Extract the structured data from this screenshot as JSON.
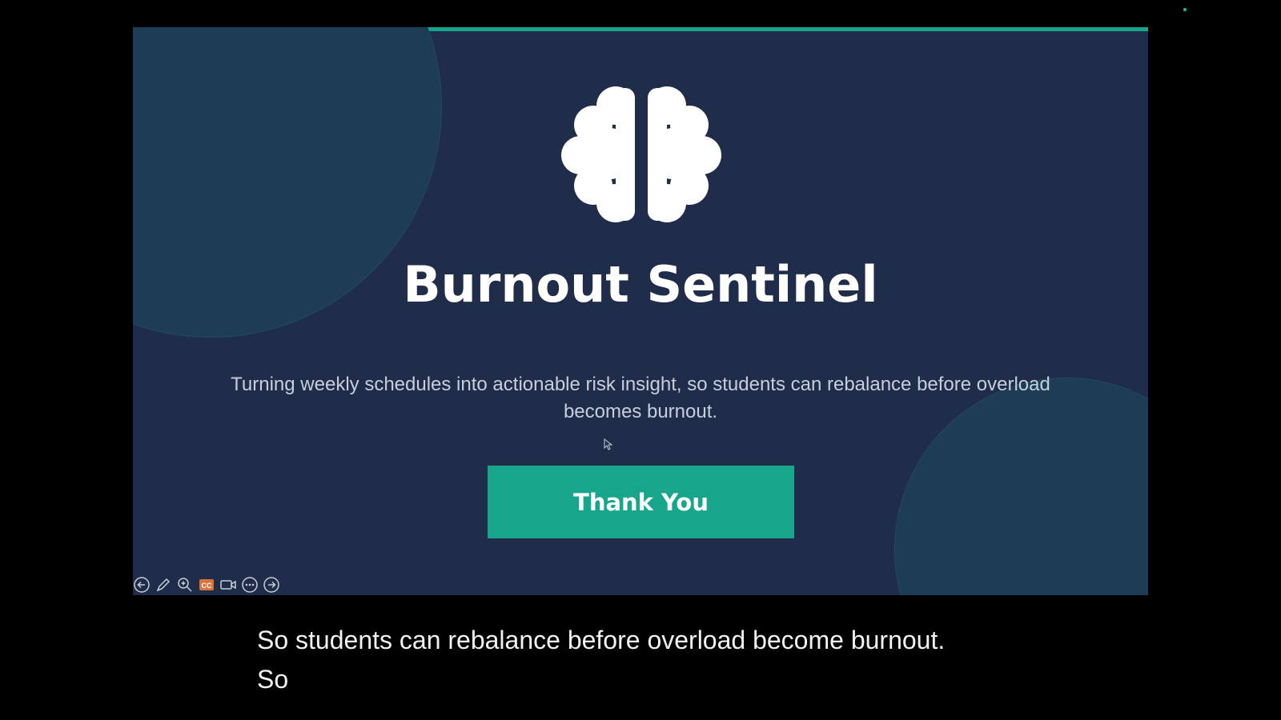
{
  "slide": {
    "title": "Burnout Sentinel",
    "subtitle": "Turning weekly schedules into actionable risk insight, so students can rebalance before overload becomes burnout.",
    "cta_label": "Thank You",
    "accent_color": "#17a68b",
    "background_color": "#1f2c4a"
  },
  "toolbar": {
    "icons": [
      "previous-icon",
      "pen-icon",
      "zoom-icon",
      "captions-icon",
      "video-icon",
      "more-options-icon",
      "next-icon"
    ],
    "captions_label": "CC"
  },
  "captions": {
    "line1": "So students can rebalance before overload become burnout.",
    "line2": "So"
  }
}
